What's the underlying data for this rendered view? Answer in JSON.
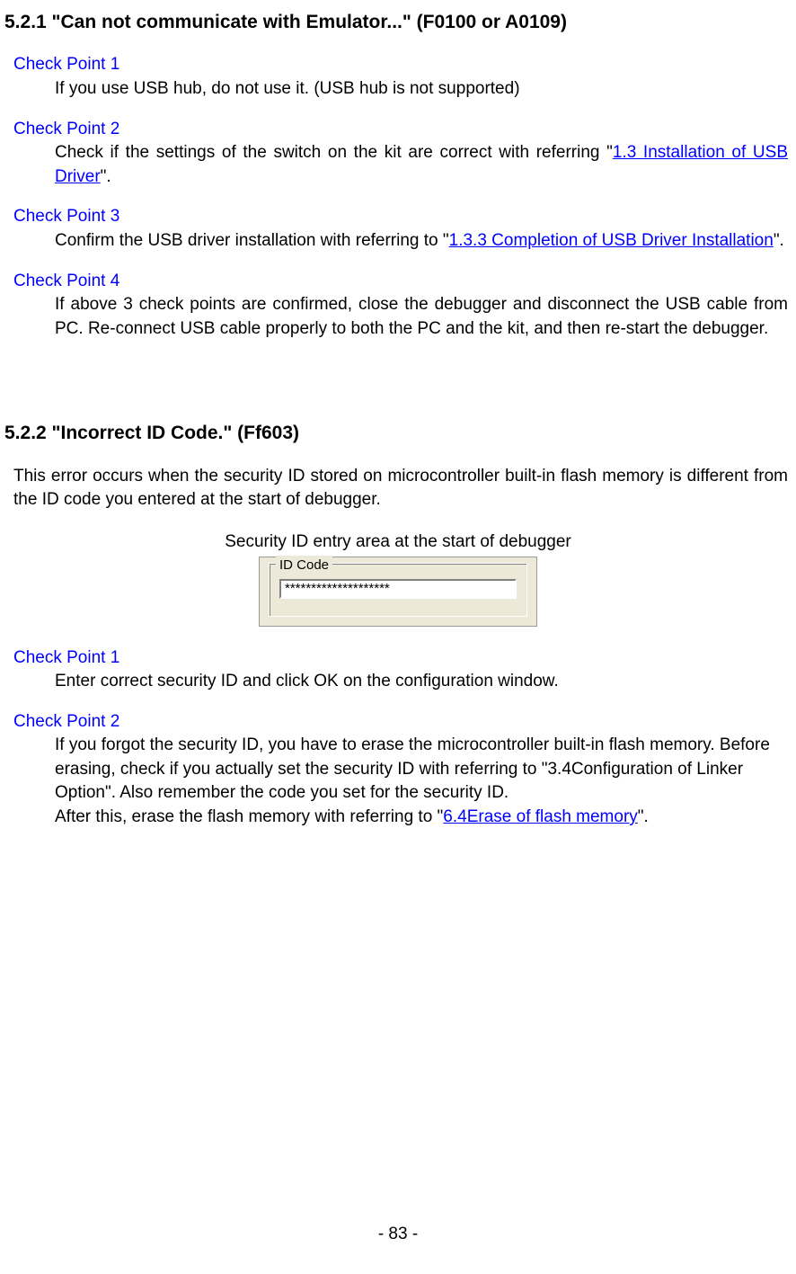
{
  "section1": {
    "heading": "5.2.1 \"Can not communicate with Emulator...\" (F0100 or A0109)",
    "cp1": {
      "label": "Check Point 1",
      "body": "If you use USB hub, do not use it. (USB hub is not supported)"
    },
    "cp2": {
      "label": "Check Point 2",
      "body_before": "Check if the settings of the switch on the kit are correct with referring \"",
      "link": "1.3 Installation of USB Driver",
      "body_after": "\"."
    },
    "cp3": {
      "label": "Check Point 3",
      "body_before": "Confirm the USB driver installation with referring to \"",
      "link": "1.3.3 Completion of USB Driver Installation",
      "body_after": "\"."
    },
    "cp4": {
      "label": "Check Point 4",
      "body": "If above 3 check points are confirmed, close the debugger and disconnect the USB cable from PC. Re-connect USB cable properly to both the PC and the kit, and then re-start the debugger."
    }
  },
  "section2": {
    "heading": "5.2.2 \"Incorrect ID Code.\" (Ff603)",
    "intro": "This error occurs when the security ID stored on microcontroller built-in flash memory is different from the ID code you entered at the start of debugger.",
    "caption": "Security ID entry area at the start of debugger",
    "idcode_legend": "ID Code",
    "idcode_value": "********************",
    "cp1": {
      "label": "Check Point 1",
      "body": "Enter correct security ID and click OK on the configuration window."
    },
    "cp2": {
      "label": "Check Point 2",
      "body1": "If you forgot the security ID, you have to erase the microcontroller built-in flash memory. Before erasing, check if you actually set the security ID with referring to \"3.4Configuration of Linker Option\". Also remember the code you set for the security ID.",
      "body2_before": "After this, erase the flash memory with referring to \"",
      "link": "6.4Erase of flash memory",
      "body2_after": "\"."
    }
  },
  "page_number": "- 83 -"
}
